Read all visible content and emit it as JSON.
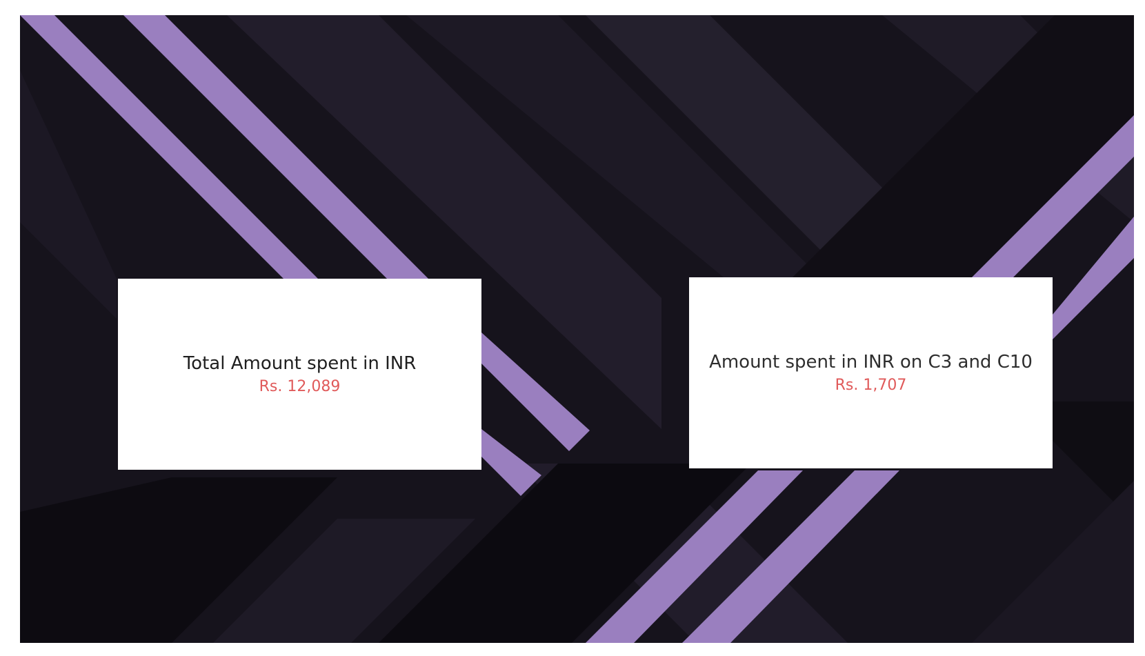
{
  "cards": [
    {
      "title": "Total Amount spent in INR",
      "value": "Rs. 12,089"
    },
    {
      "title": "Amount spent in INR on C3 and C10",
      "value": "Rs. 1,707"
    }
  ],
  "colors": {
    "background_dark": "#16131c",
    "band_dark": "#221d2b",
    "band_black": "#0d0b11",
    "stripe_purple": "#9a7fbf",
    "card_background": "#ffffff",
    "value_red": "#e05a5a"
  }
}
